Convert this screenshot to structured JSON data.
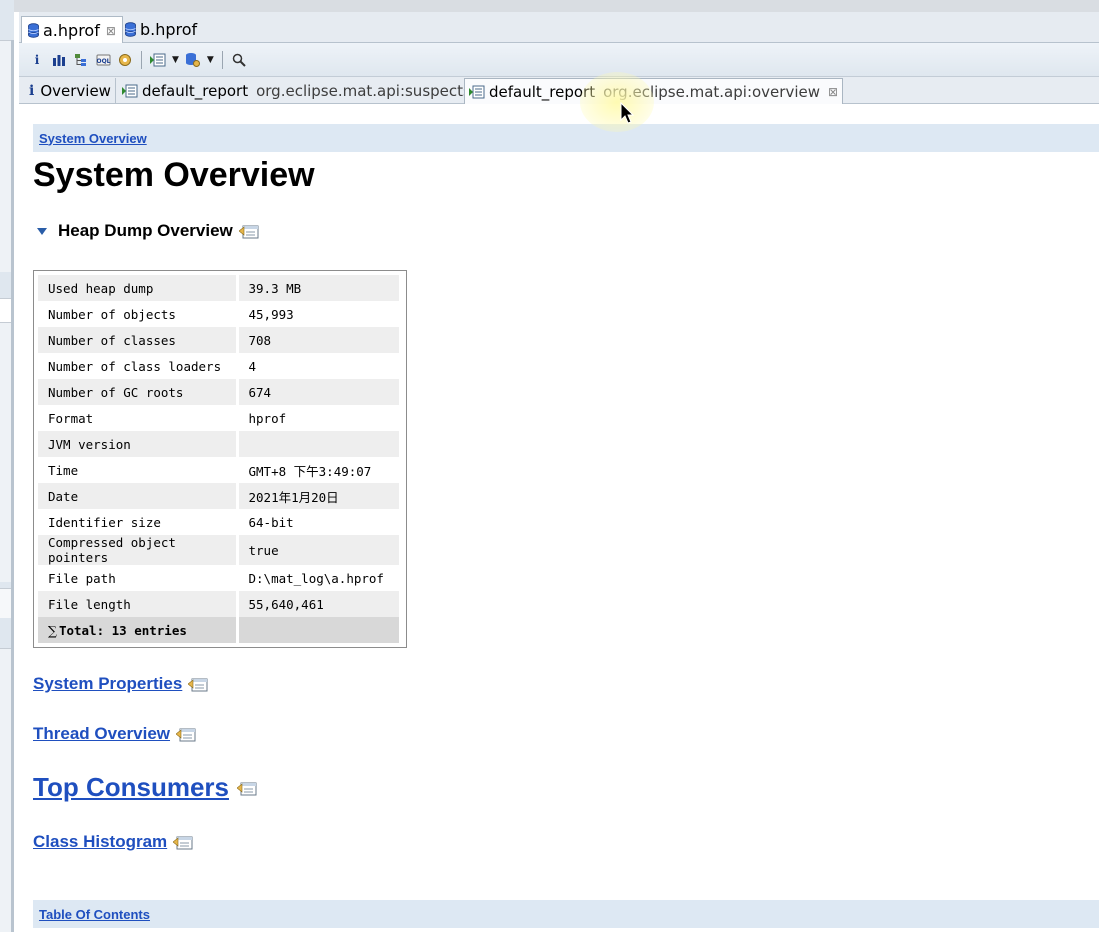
{
  "editor_tabs": [
    {
      "label": "a.hprof",
      "active": true,
      "close": "⊠"
    },
    {
      "label": "b.hprof",
      "active": false
    }
  ],
  "toolbar": {
    "icons": [
      "info-icon",
      "histogram-icon",
      "dominator-tree-icon",
      "oql-icon",
      "heap-dump-details-icon",
      "run-report-icon",
      "query-browser-icon",
      "search-icon"
    ],
    "info_glyph": "i"
  },
  "report_tabs": [
    {
      "label": "Overview",
      "icon": "info-icon",
      "active": false
    },
    {
      "label": "default_report",
      "sub": "org.eclipse.mat.api:suspects",
      "active": false
    },
    {
      "label": "default_report",
      "sub": "org.eclipse.mat.api:overview",
      "active": true,
      "close": "⊠"
    }
  ],
  "breadcrumb": "System Overview",
  "page_title": "System Overview",
  "heap_section": {
    "title": "Heap Dump Overview"
  },
  "heap_table": {
    "rows": [
      {
        "key": "Used heap dump",
        "value": "39.3 MB"
      },
      {
        "key": "Number of objects",
        "value": "45,993"
      },
      {
        "key": "Number of classes",
        "value": "708"
      },
      {
        "key": "Number of class loaders",
        "value": "4"
      },
      {
        "key": "Number of GC roots",
        "value": "674"
      },
      {
        "key": "Format",
        "value": "hprof"
      },
      {
        "key": "JVM version",
        "value": ""
      },
      {
        "key": "Time",
        "value": "GMT+8 下午3:49:07"
      },
      {
        "key": "Date",
        "value": "2021年1月20日"
      },
      {
        "key": "Identifier size",
        "value": "64-bit"
      },
      {
        "key": "Compressed object pointers",
        "value": "true"
      },
      {
        "key": "File path",
        "value": "D:\\mat_log\\a.hprof"
      },
      {
        "key": "File length",
        "value": "55,640,461"
      }
    ],
    "total_sigma": "∑",
    "total_label": "Total: 13 entries"
  },
  "links": {
    "system_properties": "System Properties",
    "thread_overview": "Thread Overview",
    "top_consumers": "Top Consumers",
    "class_histogram": "Class Histogram"
  },
  "toc": "Table Of Contents",
  "colors": {
    "link": "#1f4fbf",
    "crumb_bg": "#dde8f3",
    "toolbar_bg": "#e6ebf1"
  }
}
